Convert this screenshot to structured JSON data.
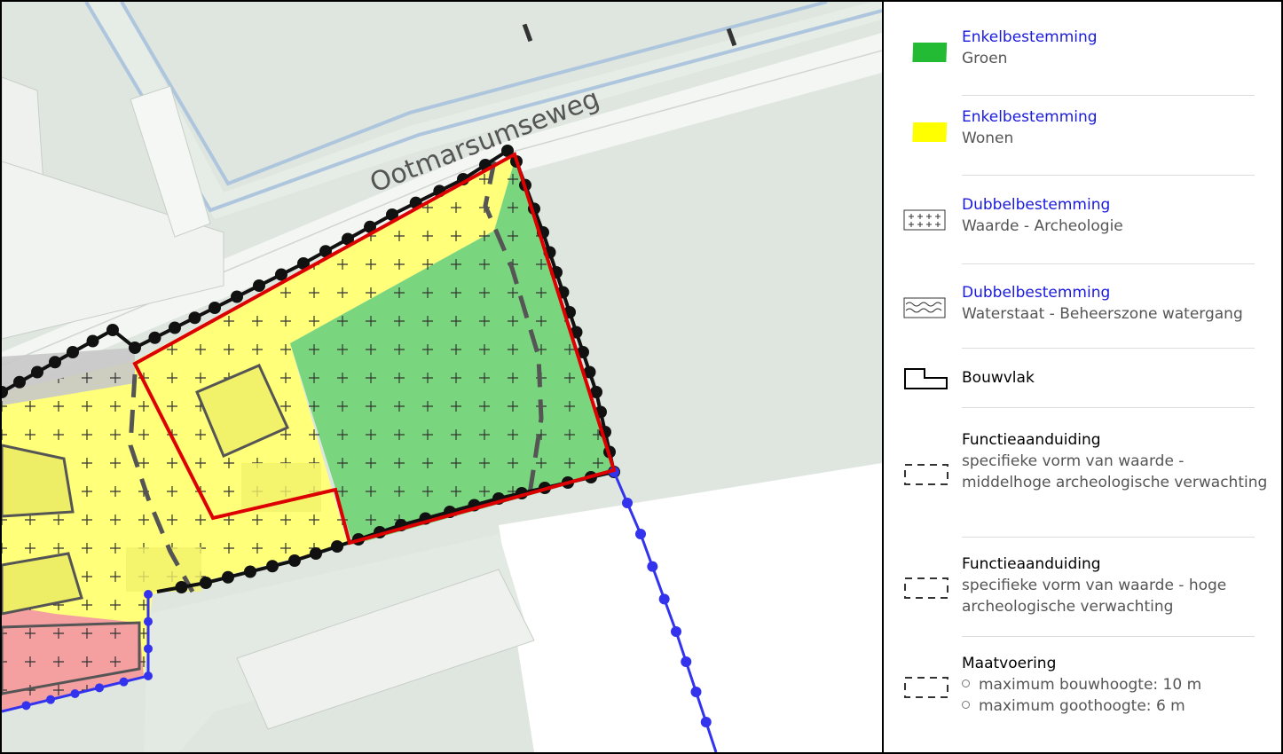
{
  "map": {
    "street_label": "Ootmarsumseweg",
    "colors": {
      "background": "#dfe6df",
      "road": "#f4f6f4",
      "water_edge": "#aec6dd",
      "groen": "#7ad67e",
      "wonen": "#ffff7a",
      "pink": "#f5a0a0",
      "highlight_red": "#dd0000",
      "boundary_blue": "#3333ee"
    }
  },
  "legend": {
    "items": [
      {
        "title": "Enkelbestemming",
        "subtitle": "Groen",
        "icon": "green-parallelogram-icon",
        "color": "#22bb33"
      },
      {
        "title": "Enkelbestemming",
        "subtitle": "Wonen",
        "icon": "yellow-parallelogram-icon",
        "color": "#ffff00"
      },
      {
        "title": "Dubbelbestemming",
        "subtitle": "Waarde - Archeologie",
        "icon": "cross-hatch-icon"
      },
      {
        "title": "Dubbelbestemming",
        "subtitle": "Waterstaat - Beheerszone watergang",
        "icon": "wave-pattern-icon"
      },
      {
        "title": "Bouwvlak",
        "icon": "bouwvlak-outline-icon"
      },
      {
        "title": "Functieaanduiding",
        "subtitle": "specifieke vorm van waarde - middelhoge archeologische verwachting",
        "icon": "dashed-rect-icon"
      },
      {
        "title": "Functieaanduiding",
        "subtitle": "specifieke vorm van waarde - hoge archeologische verwachting",
        "icon": "dashed-rect-icon"
      },
      {
        "title": "Maatvoering",
        "bullets": [
          "maximum bouwhoogte: 10 m",
          "maximum goothoogte: 6 m"
        ],
        "icon": "dashed-rect-icon"
      }
    ]
  }
}
